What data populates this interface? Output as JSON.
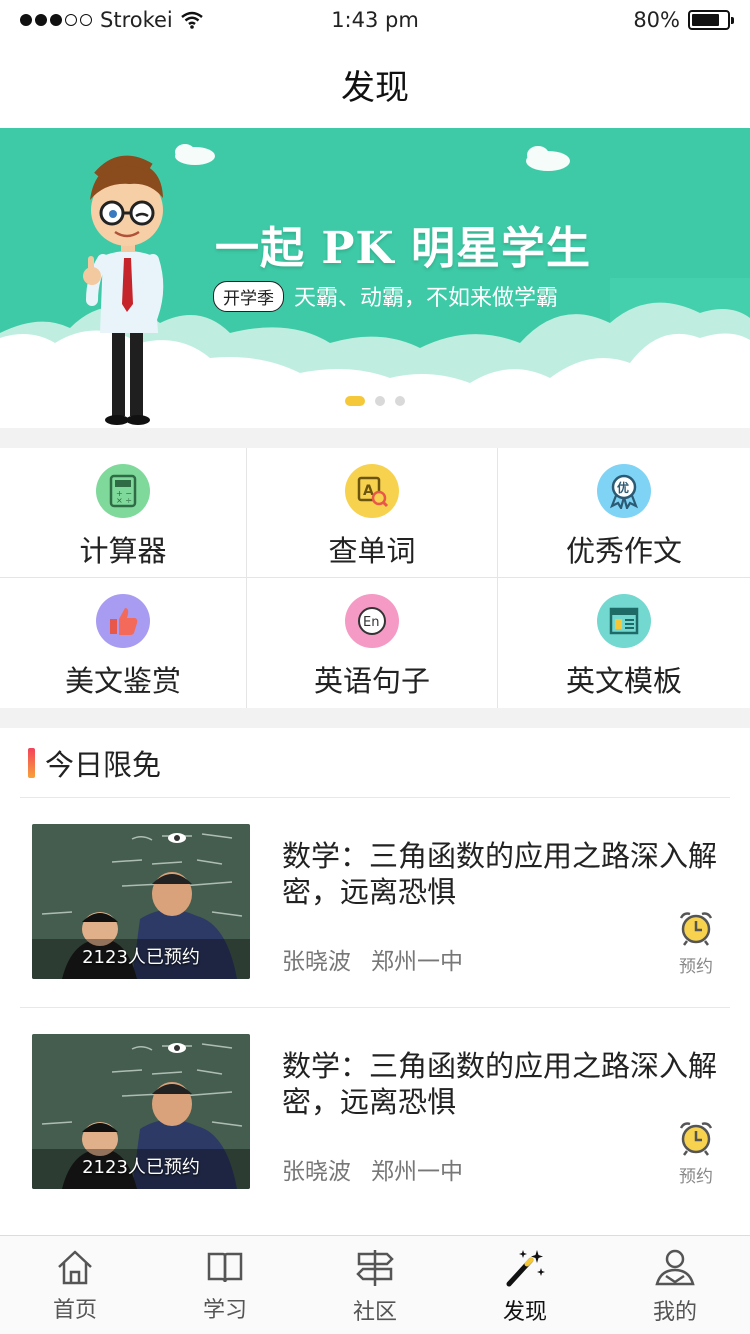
{
  "status_bar": {
    "carrier": "Strokei",
    "time": "1:43 pm",
    "battery": "80%",
    "battery_level": 0.8
  },
  "nav": {
    "title": "发现"
  },
  "banner": {
    "title": "一起 PK 明星学生",
    "tag": "开学季",
    "slogan": "天霸、动霸，不如来做学霸",
    "slides": 3,
    "active_slide": 0
  },
  "tools": [
    {
      "label": "计算器",
      "icon": "calculator-icon",
      "color": "#7ed99a"
    },
    {
      "label": "查单词",
      "icon": "word-search-icon",
      "color": "#f7d24f"
    },
    {
      "label": "优秀作文",
      "icon": "award-ribbon-icon",
      "color": "#7fd3f5"
    },
    {
      "label": "美文鉴赏",
      "icon": "thumbs-up-icon",
      "color": "#a89cf2"
    },
    {
      "label": "英语句子",
      "icon": "english-en-icon",
      "color": "#f59ac4"
    },
    {
      "label": "英文模板",
      "icon": "template-icon",
      "color": "#72d8d0"
    }
  ],
  "free_today": {
    "title": "今日限免",
    "courses": [
      {
        "title": "数学：三角函数的应用之路深入解密，远离恐惧",
        "teacher": "张晓波",
        "school": "郑州一中",
        "reservations": "2123人已预约",
        "action": "预约"
      },
      {
        "title": "数学：三角函数的应用之路深入解密，远离恐惧",
        "teacher": "张晓波",
        "school": "郑州一中",
        "reservations": "2123人已预约",
        "action": "预约"
      }
    ]
  },
  "tab_bar": {
    "items": [
      {
        "label": "首页",
        "icon": "home-icon"
      },
      {
        "label": "学习",
        "icon": "book-icon"
      },
      {
        "label": "社区",
        "icon": "signpost-icon"
      },
      {
        "label": "发现",
        "icon": "magic-wand-icon"
      },
      {
        "label": "我的",
        "icon": "user-icon"
      }
    ],
    "active": "发现"
  }
}
